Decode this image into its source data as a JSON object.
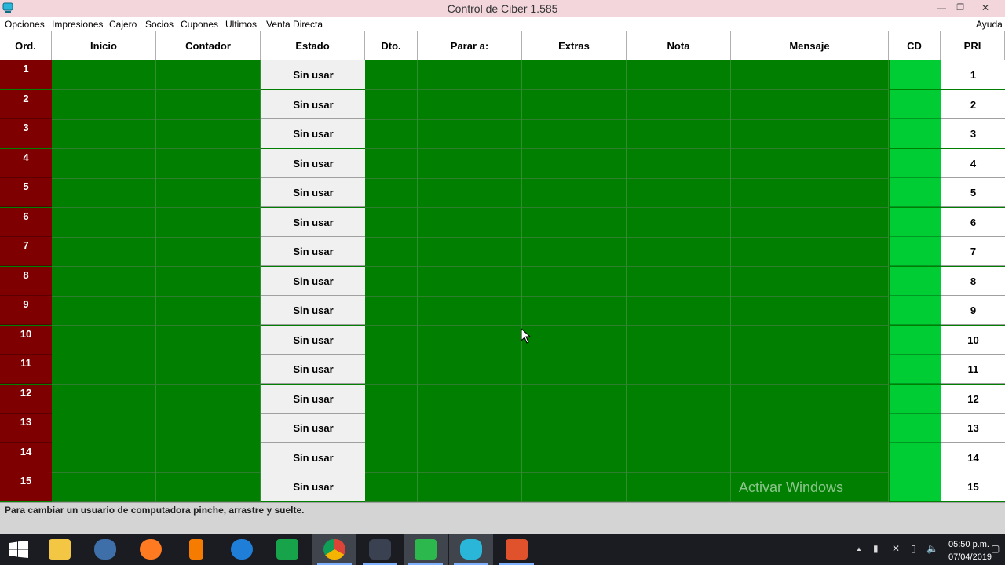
{
  "window": {
    "title": "Control de Ciber 1.585",
    "min_glyph": "—",
    "max_glyph": "❐",
    "close_glyph": "✕"
  },
  "menu": {
    "items": [
      "Opciones",
      "Impresiones",
      "Cajero",
      "Socios",
      "Cupones",
      "Ultimos",
      "Venta Directa"
    ],
    "help": "Ayuda"
  },
  "table": {
    "headers": [
      "Ord.",
      "Inicio",
      "Contador",
      "Estado",
      "Dto.",
      "Parar a:",
      "Extras",
      "Nota",
      "Mensaje",
      "CD",
      "PRI"
    ],
    "rows": [
      {
        "ord": "1",
        "estado": "Sin usar",
        "pri": "1"
      },
      {
        "ord": "2",
        "estado": "Sin usar",
        "pri": "2"
      },
      {
        "ord": "3",
        "estado": "Sin usar",
        "pri": "3"
      },
      {
        "ord": "4",
        "estado": "Sin usar",
        "pri": "4"
      },
      {
        "ord": "5",
        "estado": "Sin usar",
        "pri": "5"
      },
      {
        "ord": "6",
        "estado": "Sin usar",
        "pri": "6"
      },
      {
        "ord": "7",
        "estado": "Sin usar",
        "pri": "7"
      },
      {
        "ord": "8",
        "estado": "Sin usar",
        "pri": "8"
      },
      {
        "ord": "9",
        "estado": "Sin usar",
        "pri": "9"
      },
      {
        "ord": "10",
        "estado": "Sin usar",
        "pri": "10"
      },
      {
        "ord": "11",
        "estado": "Sin usar",
        "pri": "11"
      },
      {
        "ord": "12",
        "estado": "Sin usar",
        "pri": "12"
      },
      {
        "ord": "13",
        "estado": "Sin usar",
        "pri": "13"
      },
      {
        "ord": "14",
        "estado": "Sin usar",
        "pri": "14"
      },
      {
        "ord": "15",
        "estado": "Sin usar",
        "pri": "15"
      }
    ]
  },
  "watermark": "Activar Windows",
  "status": {
    "text": "Para cambiar un usuario de computadora pinche, arrastre y suelte."
  },
  "taskbar": {
    "apps": [
      "windows-start-icon",
      "file-explorer-icon",
      "postgresql-icon",
      "firefox-icon",
      "sublime-text-icon",
      "browser-c-icon",
      "store-icon",
      "chrome-icon",
      "nox-icon",
      "camtasia-icon",
      "control-de-ciber-icon",
      "camtasia-recorder-icon"
    ],
    "tray_up": "▲",
    "tray_signal": "▮",
    "tray_network": "✕",
    "tray_battery": "▯",
    "tray_volume": "🔈",
    "tray_notify": "▢",
    "time": "05:50 p.m.",
    "date": "07/04/2019"
  },
  "colors": {
    "grid_green": "#007f00",
    "ord_red": "#7f0000",
    "cd_green": "#00cc33",
    "titlebar": "#f2d6dc"
  }
}
